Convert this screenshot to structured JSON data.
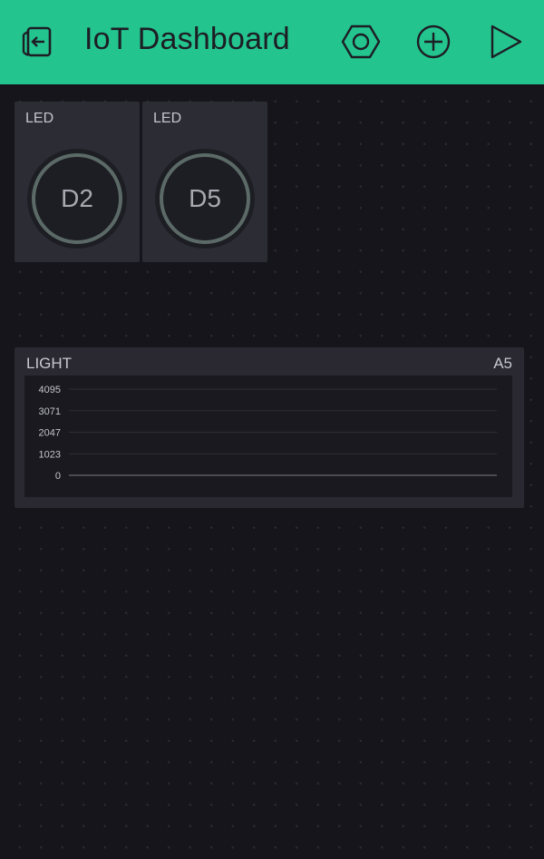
{
  "header": {
    "title": "IoT Dashboard",
    "background_color": "#23c48e",
    "icons": {
      "exit": "exit-project-icon",
      "settings": "hexagon-settings-icon",
      "add": "add-widget-icon",
      "play": "play-icon"
    }
  },
  "widgets": {
    "led1": {
      "label": "LED",
      "pin": "D2"
    },
    "led2": {
      "label": "LED",
      "pin": "D5"
    },
    "chart": {
      "label": "LIGHT",
      "pin": "A5"
    }
  },
  "chart_data": {
    "type": "line",
    "title": "LIGHT",
    "pin": "A5",
    "y_ticks": [
      "4095",
      "3071",
      "2047",
      "1023",
      "0"
    ],
    "ylim": [
      0,
      4095
    ],
    "grid": true,
    "series": [
      {
        "values": []
      }
    ]
  }
}
